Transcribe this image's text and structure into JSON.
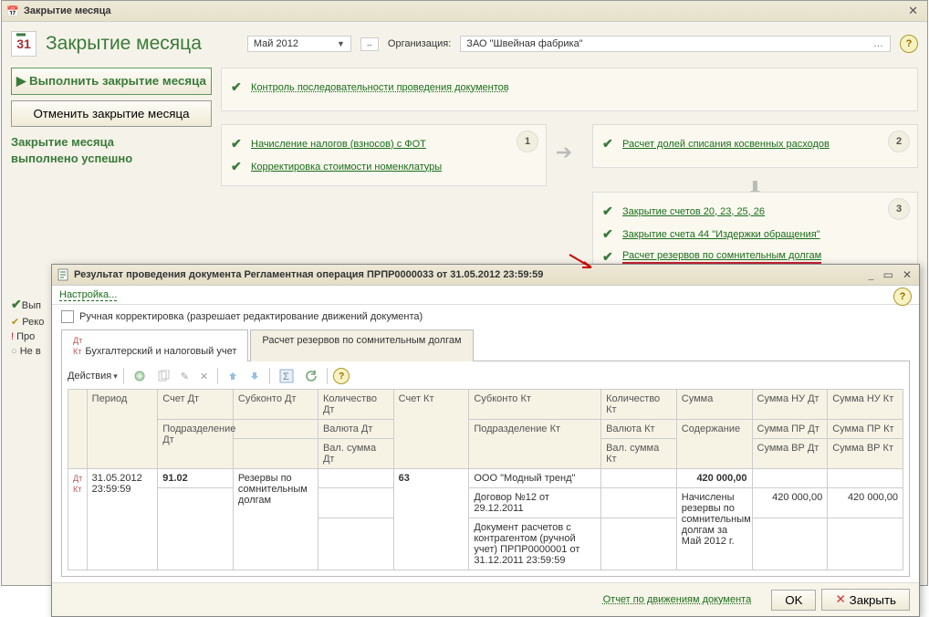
{
  "main_window": {
    "title": "Закрытие месяца",
    "header_title": "Закрытие месяца",
    "period": "Май 2012",
    "org_label": "Организация:",
    "org_value": "ЗАО \"Швейная фабрика\"",
    "btn_execute": "Выполнить закрытие месяца",
    "btn_cancel": "Отменить закрытие месяца",
    "status_line1": "Закрытие месяца",
    "status_line2": "выполнено успешно",
    "control_link": "Контроль последовательности проведения документов",
    "p1_num": "1",
    "p2_num": "2",
    "p3_num": "3",
    "p1_items": [
      "Начисление налогов (взносов) с ФОТ",
      "Корректировка стоимости номенклатуры"
    ],
    "p2_items": [
      "Расчет долей списания косвенных расходов"
    ],
    "p3_items": [
      "Закрытие счетов 20, 23, 25, 26",
      "Закрытие счета 44 \"Издержки обращения\"",
      "Расчет резервов по сомнительным долгам"
    ],
    "partial_lines": {
      "l1": "Вып",
      "l2": "Реко",
      "l3": "Про",
      "l4": "Не в"
    }
  },
  "result_window": {
    "title": "Результат проведения документа Регламентная операция ПРПР0000033 от 31.05.2012 23:59:59",
    "settings_link": "Настройка...",
    "manual_checkbox": "Ручная корректировка (разрешает редактирование движений документа)",
    "tab1": "Бухгалтерский и налоговый учет",
    "tab2": "Расчет резервов по сомнительным долгам",
    "actions_label": "Действия",
    "headers": {
      "period": "Период",
      "dt_acc": "Счет Дт",
      "dt_sub": "Субконто Дт",
      "dt_qty": "Количество Дт",
      "kt_acc": "Счет Кт",
      "kt_sub": "Субконто Кт",
      "kt_qty": "Количество Кт",
      "sum": "Сумма",
      "nu_dt": "Сумма НУ Дт",
      "nu_kt": "Сумма НУ Кт",
      "dt_dept": "Подразделение Дт",
      "dt_cur": "Валюта Дт",
      "kt_dept": "Подразделение Кт",
      "kt_cur": "Валюта Кт",
      "content": "Содержание",
      "pr_dt": "Сумма ПР Дт",
      "pr_kt": "Сумма ПР Кт",
      "dt_cursum": "Вал. сумма Дт",
      "kt_cursum": "Вал. сумма Кт",
      "vr_dt": "Сумма ВР Дт",
      "vr_kt": "Сумма ВР Кт"
    },
    "row": {
      "period": "31.05.2012 23:59:59",
      "dt_acc": "91.02",
      "dt_sub": "Резервы по сомнительным долгам",
      "kt_acc": "63",
      "kt_sub1": "ООО \"Модный тренд\"",
      "kt_sub2": "Договор №12 от 29.12.2011",
      "kt_sub3": "Документ расчетов с контрагентом (ручной учет) ПРПР0000001 от 31.12.2011 23:59:59",
      "sum": "420 000,00",
      "content": "Начислены резервы по сомнительным долгам за Май 2012 г.",
      "nu_dt": "420 000,00",
      "nu_kt": "420 000,00"
    },
    "report_link": "Отчет по движениям документа",
    "btn_ok": "OK",
    "btn_close": "Закрыть"
  }
}
